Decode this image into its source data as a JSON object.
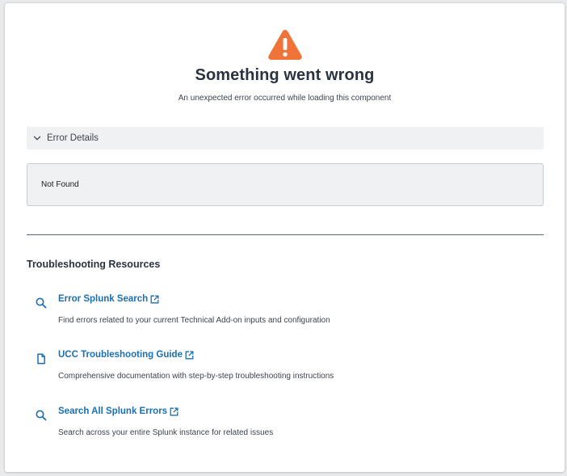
{
  "error": {
    "title": "Something went wrong",
    "subtitle": "An unexpected error occurred while loading this component",
    "icon": "warning-triangle-icon",
    "accent_color": "#f0743a"
  },
  "details": {
    "toggle_label": "Error Details",
    "expanded": true,
    "message": "Not Found"
  },
  "resources": {
    "heading": "Troubleshooting Resources",
    "link_color": "#1a6fb3",
    "items": [
      {
        "icon": "search-icon",
        "label": "Error Splunk Search",
        "description": "Find errors related to your current Technical Add-on inputs and configuration"
      },
      {
        "icon": "document-icon",
        "label": "UCC Troubleshooting Guide",
        "description": "Comprehensive documentation with step-by-step troubleshooting instructions"
      },
      {
        "icon": "search-icon",
        "label": "Search All Splunk Errors",
        "description": "Search across your entire Splunk instance for related issues"
      }
    ]
  }
}
